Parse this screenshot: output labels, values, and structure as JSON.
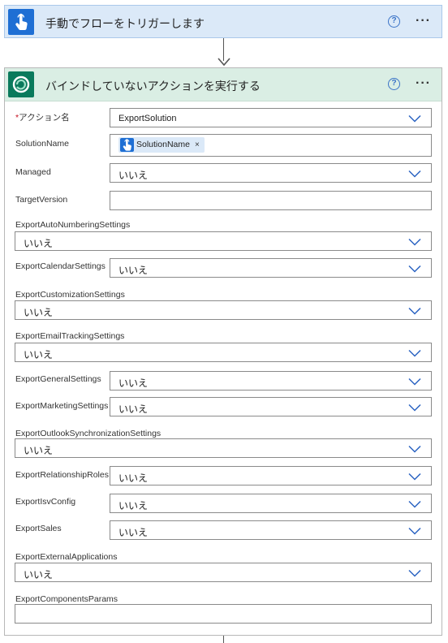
{
  "trigger": {
    "title": "手動でフローをトリガーします",
    "help_glyph": "?",
    "more_glyph": "···",
    "icon": "touch-hand-icon"
  },
  "action": {
    "title": "バインドしていないアクションを実行する",
    "help_glyph": "?",
    "more_glyph": "···",
    "icon": "dataverse-icon"
  },
  "fields": {
    "action_name": {
      "label": "アクション名",
      "required_mark": "*",
      "value": "ExportSolution"
    },
    "solution_name": {
      "label": "SolutionName",
      "token_label": "SolutionName",
      "token_close": "×"
    },
    "managed": {
      "label": "Managed",
      "value": "いいえ"
    },
    "target_version": {
      "label": "TargetVersion",
      "value": ""
    },
    "export_auto_numbering_settings": {
      "label": "ExportAutoNumberingSettings",
      "value": "いいえ"
    },
    "export_calendar_settings": {
      "label": "ExportCalendarSettings",
      "value": "いいえ"
    },
    "export_customization_settings": {
      "label": "ExportCustomizationSettings",
      "value": "いいえ"
    },
    "export_email_tracking_settings": {
      "label": "ExportEmailTrackingSettings",
      "value": "いいえ"
    },
    "export_general_settings": {
      "label": "ExportGeneralSettings",
      "value": "いいえ"
    },
    "export_marketing_settings": {
      "label": "ExportMarketingSettings",
      "value": "いいえ"
    },
    "export_outlook_synchronization_settings": {
      "label": "ExportOutlookSynchronizationSettings",
      "value": "いいえ"
    },
    "export_relationship_roles": {
      "label": "ExportRelationshipRoles",
      "value": "いいえ"
    },
    "export_isv_config": {
      "label": "ExportIsvConfig",
      "value": "いいえ"
    },
    "export_sales": {
      "label": "ExportSales",
      "value": "いいえ"
    },
    "export_external_applications": {
      "label": "ExportExternalApplications",
      "value": "いいえ"
    },
    "export_components_params": {
      "label": "ExportComponentsParams",
      "value": ""
    }
  },
  "colors": {
    "trigger_header": "#dbe9f8",
    "action_header": "#daeee4",
    "trigger_icon": "#1f6fd4",
    "action_icon": "#0a7a5c",
    "chevron": "#2b63c2",
    "required": "#c50f1f"
  }
}
